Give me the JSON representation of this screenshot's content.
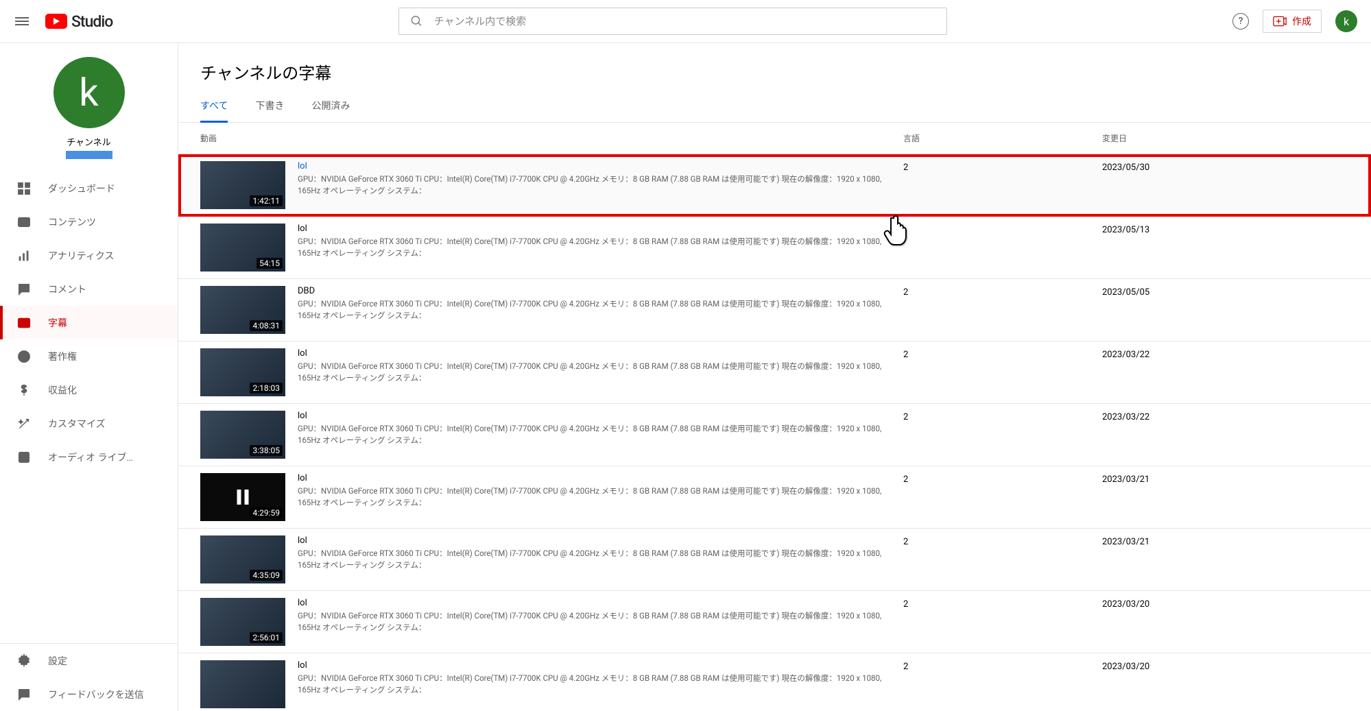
{
  "header": {
    "studio_label": "Studio",
    "search_placeholder": "チャンネル内で検索",
    "create_label": "作成",
    "avatar_letter": "k"
  },
  "sidebar": {
    "channel_avatar_letter": "k",
    "channel_label": "チャンネル",
    "nav": [
      {
        "key": "dashboard",
        "label": "ダッシュボード"
      },
      {
        "key": "content",
        "label": "コンテンツ"
      },
      {
        "key": "analytics",
        "label": "アナリティクス"
      },
      {
        "key": "comments",
        "label": "コメント"
      },
      {
        "key": "subtitles",
        "label": "字幕"
      },
      {
        "key": "copyright",
        "label": "著作権"
      },
      {
        "key": "monetization",
        "label": "収益化"
      },
      {
        "key": "customize",
        "label": "カスタマイズ"
      },
      {
        "key": "audio",
        "label": "オーディオ ライブ…"
      }
    ],
    "settings_label": "設定",
    "feedback_label": "フィードバックを送信"
  },
  "page": {
    "title": "チャンネルの字幕",
    "tabs": [
      {
        "label": "すべて",
        "active": true
      },
      {
        "label": "下書き",
        "active": false
      },
      {
        "label": "公開済み",
        "active": false
      }
    ],
    "columns": {
      "video": "動画",
      "lang": "言語",
      "date": "変更日"
    },
    "desc": "GPU：NVIDIA GeForce RTX 3060 Ti CPU：Intel(R) Core(TM) i7-7700K CPU @ 4.20GHz メモリ：8 GB RAM (7.88 GB RAM は使用可能です) 現在の解像度：1920 x 1080, 165Hz オペレーティング システム：",
    "rows": [
      {
        "title": "lol",
        "duration": "1:42:11",
        "lang": "2",
        "date": "2023/05/30",
        "highlight": true,
        "dark": false
      },
      {
        "title": "lol",
        "duration": "54:15",
        "lang": "",
        "date": "2023/05/13",
        "highlight": false,
        "dark": false
      },
      {
        "title": "DBD",
        "duration": "4:08:31",
        "lang": "2",
        "date": "2023/05/05",
        "highlight": false,
        "dark": false
      },
      {
        "title": "lol",
        "duration": "2:18:03",
        "lang": "2",
        "date": "2023/03/22",
        "highlight": false,
        "dark": false
      },
      {
        "title": "lol",
        "duration": "3:38:05",
        "lang": "2",
        "date": "2023/03/22",
        "highlight": false,
        "dark": false
      },
      {
        "title": "lol",
        "duration": "4:29:59",
        "lang": "2",
        "date": "2023/03/21",
        "highlight": false,
        "dark": true
      },
      {
        "title": "lol",
        "duration": "4:35:09",
        "lang": "2",
        "date": "2023/03/21",
        "highlight": false,
        "dark": false
      },
      {
        "title": "lol",
        "duration": "2:56:01",
        "lang": "2",
        "date": "2023/03/20",
        "highlight": false,
        "dark": false
      },
      {
        "title": "lol",
        "duration": "",
        "lang": "2",
        "date": "2023/03/20",
        "highlight": false,
        "dark": false
      }
    ]
  }
}
